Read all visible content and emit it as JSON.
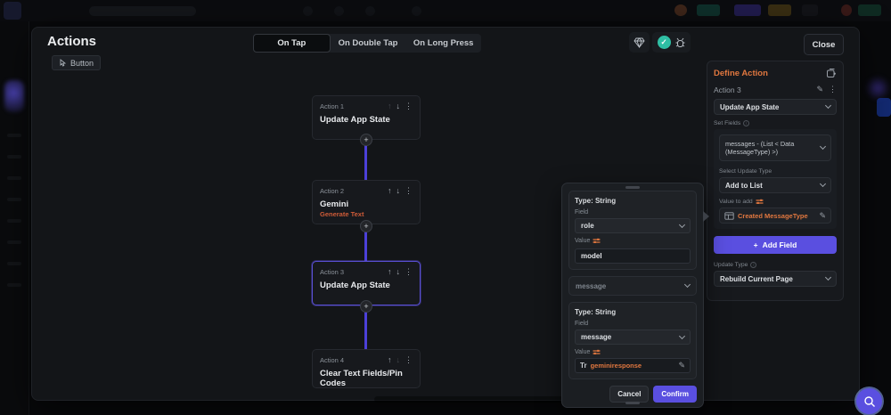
{
  "colors": {
    "accent_purple": "#5a4fe0",
    "accent_orange": "#e0773f",
    "subtitle_orange": "#cf5c38",
    "teal": "#2fbfa4",
    "selected_node_border": "#5b50d6",
    "connector": "#4c40d8"
  },
  "glyphs": {
    "up": "↑",
    "down": "↓",
    "dots": "⋮",
    "pencil": "✎",
    "check": "✓",
    "plus": "+",
    "tr": "Tr"
  },
  "header": {
    "title": "Actions",
    "element_chip": "Button",
    "tabs": [
      {
        "label": "On Tap",
        "active": true
      },
      {
        "label": "On Double Tap",
        "active": false
      },
      {
        "label": "On Long Press",
        "active": false
      }
    ],
    "close_label": "Close"
  },
  "flow": {
    "nodes": [
      {
        "label": "Action 1",
        "title": "Update App State",
        "subtitle": ""
      },
      {
        "label": "Action 2",
        "title": "Gemini",
        "subtitle": "Generate Text"
      },
      {
        "label": "Action 3",
        "title": "Update App State",
        "subtitle": "",
        "selected": true
      },
      {
        "label": "Action 4",
        "title": "Clear Text Fields/Pin Codes",
        "subtitle": ""
      }
    ]
  },
  "panel": {
    "title": "Define Action",
    "action_label": "Action 3",
    "action_type_value": "Update App State",
    "set_fields_label": "Set Fields",
    "field_binding_value": "messages - (List < Data (MessageType) >)",
    "select_update_type_label": "Select Update Type",
    "update_type_value": "Add to List",
    "value_to_add_label": "Value to add",
    "value_to_add_value": "Created MessageType",
    "add_field_label": "Add Field",
    "update_type_label": "Update Type",
    "page_update_value": "Rebuild Current Page"
  },
  "popup": {
    "sections": [
      {
        "type_label": "Type: String",
        "field_label": "Field",
        "field_value": "role",
        "value_label": "Value",
        "value": "model"
      },
      {
        "header": "message",
        "type_label": "Type: String",
        "field_label": "Field",
        "field_value": "message",
        "value_label": "Value",
        "value": "geminiresponse"
      }
    ],
    "cancel_label": "Cancel",
    "confirm_label": "Confirm"
  }
}
